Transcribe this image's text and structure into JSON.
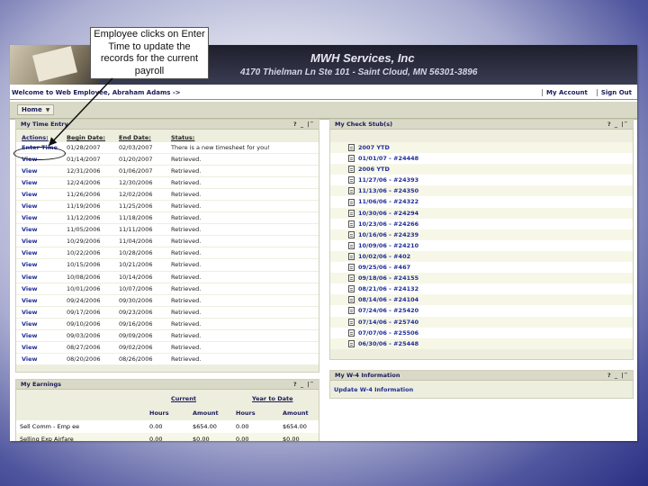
{
  "banner": {
    "company_name": "MWH Services, Inc",
    "company_address": "4170 Thielman Ln Ste 101 - Saint Cloud, MN 56301-3896"
  },
  "welcome_bar": {
    "welcome_text": "Welcome to Web Employee, Abraham Adams ->",
    "my_account": "My Account",
    "sign_out": "Sign Out"
  },
  "tabs": {
    "home": "Home"
  },
  "time_entry": {
    "title": "My Time Entry",
    "controls": "? _ |‾",
    "columns": [
      "Actions:",
      "Begin Date:",
      "End Date:",
      "Status:"
    ],
    "rows": [
      {
        "action": "Enter Time",
        "begin": "01/28/2007",
        "end": "02/03/2007",
        "status": "There is a new timesheet for you!"
      },
      {
        "action": "View",
        "begin": "01/14/2007",
        "end": "01/20/2007",
        "status": "Retrieved."
      },
      {
        "action": "View",
        "begin": "12/31/2006",
        "end": "01/06/2007",
        "status": "Retrieved."
      },
      {
        "action": "View",
        "begin": "12/24/2006",
        "end": "12/30/2006",
        "status": "Retrieved."
      },
      {
        "action": "View",
        "begin": "11/26/2006",
        "end": "12/02/2006",
        "status": "Retrieved."
      },
      {
        "action": "View",
        "begin": "11/19/2006",
        "end": "11/25/2006",
        "status": "Retrieved."
      },
      {
        "action": "View",
        "begin": "11/12/2006",
        "end": "11/18/2006",
        "status": "Retrieved."
      },
      {
        "action": "View",
        "begin": "11/05/2006",
        "end": "11/11/2006",
        "status": "Retrieved."
      },
      {
        "action": "View",
        "begin": "10/29/2006",
        "end": "11/04/2006",
        "status": "Retrieved."
      },
      {
        "action": "View",
        "begin": "10/22/2006",
        "end": "10/28/2006",
        "status": "Retrieved."
      },
      {
        "action": "View",
        "begin": "10/15/2006",
        "end": "10/21/2006",
        "status": "Retrieved."
      },
      {
        "action": "View",
        "begin": "10/08/2006",
        "end": "10/14/2006",
        "status": "Retrieved."
      },
      {
        "action": "View",
        "begin": "10/01/2006",
        "end": "10/07/2006",
        "status": "Retrieved."
      },
      {
        "action": "View",
        "begin": "09/24/2006",
        "end": "09/30/2006",
        "status": "Retrieved."
      },
      {
        "action": "View",
        "begin": "09/17/2006",
        "end": "09/23/2006",
        "status": "Retrieved."
      },
      {
        "action": "View",
        "begin": "09/10/2006",
        "end": "09/16/2006",
        "status": "Retrieved."
      },
      {
        "action": "View",
        "begin": "09/03/2006",
        "end": "09/09/2006",
        "status": "Retrieved."
      },
      {
        "action": "View",
        "begin": "08/27/2006",
        "end": "09/02/2006",
        "status": "Retrieved."
      },
      {
        "action": "View",
        "begin": "08/20/2006",
        "end": "08/26/2006",
        "status": "Retrieved."
      }
    ]
  },
  "check_stubs": {
    "title": "My Check Stub(s)",
    "controls": "? _ |‾",
    "items": [
      "2007 YTD",
      "01/01/07 - #24448",
      "2006 YTD",
      "11/27/06 - #24393",
      "11/13/06 - #24350",
      "11/06/06 - #24322",
      "10/30/06 - #24294",
      "10/23/06 - #24266",
      "10/16/06 - #24239",
      "10/09/06 - #24210",
      "10/02/06 - #402",
      "09/25/06 - #467",
      "09/18/06 - #24155",
      "08/21/06 - #24132",
      "08/14/06 - #24104",
      "07/24/06 - #25420",
      "07/14/06 - #25740",
      "07/07/06 - #25506",
      "06/30/06 - #25448"
    ]
  },
  "w4": {
    "title": "My W-4 Information",
    "controls": "? _ |‾",
    "link": "Update W-4 Information"
  },
  "earnings": {
    "title": "My Earnings",
    "controls": "? _ |‾",
    "group_current": "Current",
    "group_ytd": "Year to Date",
    "columns": [
      "Hours",
      "Amount",
      "Hours",
      "Amount"
    ],
    "rows": [
      {
        "label": "Sell Comm - Emp ee",
        "c_hours": "0.00",
        "c_amount": "$654.00",
        "y_hours": "0.00",
        "y_amount": "$654.00"
      },
      {
        "label": "Selling Exp Airfare",
        "c_hours": "0.00",
        "c_amount": "$0.00",
        "y_hours": "0.00",
        "y_amount": "$0.00"
      }
    ]
  },
  "callout": {
    "text": "Employee clicks on Enter Time to update the records for the current payroll"
  }
}
